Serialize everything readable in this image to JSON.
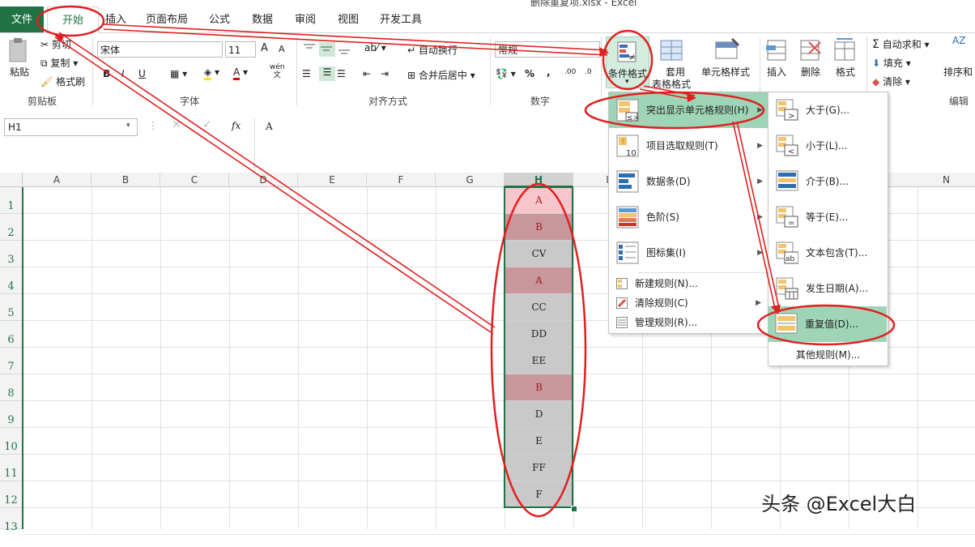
{
  "window": {
    "title": "删除重复项.xlsx - Excel"
  },
  "tabs": [
    "文件",
    "开始",
    "插入",
    "页面布局",
    "公式",
    "数据",
    "审阅",
    "视图",
    "开发工具"
  ],
  "clipboard": {
    "paste": "粘贴",
    "cut": "剪切",
    "copy": "复制",
    "format_painter": "格式刷",
    "group": "剪贴板"
  },
  "font": {
    "name": "宋体",
    "size": "11",
    "bold": "B",
    "italic": "I",
    "underline": "U",
    "group": "字体",
    "grow": "A",
    "shrink": "A",
    "phonetic_top": "wén",
    "phonetic_bottom": "文"
  },
  "alignment": {
    "wrap": "自动换行",
    "merge": "合并后居中",
    "group": "对齐方式"
  },
  "number": {
    "format": "常规",
    "percent": "%",
    "comma": ",",
    "inc": ".00",
    "dec": ".0",
    "group": "数字"
  },
  "styles": {
    "conditional": "条件格式",
    "table_l1": "套用",
    "table_l2": "表格格式",
    "cell_styles": "单元格样式"
  },
  "cells": {
    "insert": "插入",
    "delete": "删除",
    "format": "格式"
  },
  "editing": {
    "autosum": "自动求和",
    "fill": "填充",
    "clear": "清除",
    "sort": "排序和",
    "group": "编辑",
    "sort_letters": "AZ"
  },
  "formula_bar": {
    "name_box": "H1",
    "fx": "fx",
    "value": "A"
  },
  "columns": [
    "A",
    "B",
    "C",
    "D",
    "E",
    "F",
    "G",
    "H",
    "I",
    "N"
  ],
  "rows": [
    "1",
    "2",
    "3",
    "4",
    "5",
    "6",
    "7",
    "8",
    "9",
    "10",
    "11",
    "12",
    "13"
  ],
  "column_h": [
    {
      "v": "A",
      "dup": true
    },
    {
      "v": "B",
      "dup": true
    },
    {
      "v": "CV",
      "dup": false
    },
    {
      "v": "A",
      "dup": true
    },
    {
      "v": "CC",
      "dup": false
    },
    {
      "v": "DD",
      "dup": false
    },
    {
      "v": "EE",
      "dup": false
    },
    {
      "v": "B",
      "dup": true
    },
    {
      "v": "D",
      "dup": false
    },
    {
      "v": "E",
      "dup": false
    },
    {
      "v": "FF",
      "dup": false
    },
    {
      "v": "F",
      "dup": false
    }
  ],
  "cf_menu": {
    "items": [
      "突出显示单元格规则(H)",
      "项目选取规则(T)",
      "数据条(D)",
      "色阶(S)",
      "图标集(I)"
    ],
    "small_items": [
      "新建规则(N)...",
      "清除规则(C)",
      "管理规则(R)..."
    ]
  },
  "highlight_menu": {
    "items": [
      "大于(G)...",
      "小于(L)...",
      "介于(B)...",
      "等于(E)...",
      "文本包含(T)...",
      "发生日期(A)...",
      "重复值(D)..."
    ],
    "other": "其他规则(M)..."
  },
  "watermark": "头条 @Excel大白",
  "colors": {
    "excel_green": "#217346",
    "highlight": "#9fd5b7",
    "dup_fill": "#c9969b",
    "dup_text": "#9c1f28",
    "annotation": "#e02020",
    "gray_fill": "#c9c9c9"
  }
}
